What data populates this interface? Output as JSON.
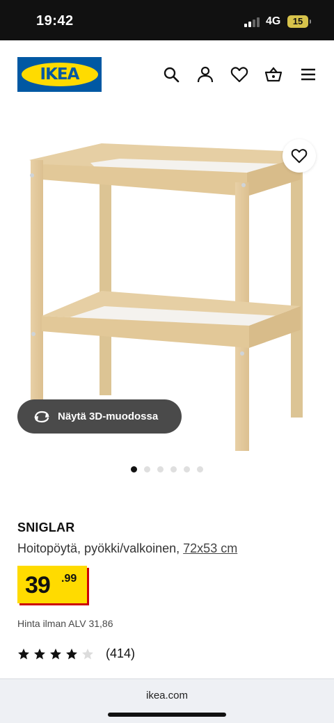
{
  "status_bar": {
    "time": "19:42",
    "network": "4G",
    "battery": "15"
  },
  "header": {
    "logo_text": "IKEA",
    "icons": [
      "search-icon",
      "user-icon",
      "heart-icon",
      "basket-icon",
      "menu-icon"
    ]
  },
  "gallery": {
    "view_3d_label": "Näytä 3D-muodossa",
    "dot_count": 6,
    "active_dot": 1
  },
  "product": {
    "name": "SNIGLAR",
    "description": "Hoitopöytä, pyökki/valkoinen,",
    "size": "72x53 cm",
    "price_integer": "39",
    "price_decimal": ".99",
    "vat_text": "Hinta ilman ALV 31,86",
    "rating_stars": 4,
    "rating_max": 5,
    "review_count": "(414)"
  },
  "browser": {
    "url": "ikea.com"
  },
  "colors": {
    "ikea_blue": "#0058a3",
    "ikea_yellow": "#ffdb00",
    "price_shadow_red": "#cc0008"
  }
}
